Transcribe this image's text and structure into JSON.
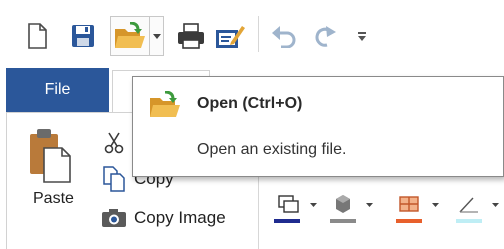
{
  "colors": {
    "file_tab_bg": "#2b579a",
    "icon_blue": "#2b579a",
    "folder_orange": "#e3a537",
    "arrow_green": "#3d9a3d",
    "disabled_gray": "#9fb4cc"
  },
  "quick_access_toolbar": {
    "buttons": [
      {
        "icon": "new-document-icon"
      },
      {
        "icon": "save-icon"
      },
      {
        "icon": "open-folder-icon",
        "has_dropdown": true
      },
      {
        "icon": "print-icon"
      },
      {
        "icon": "print-edit-icon"
      },
      {
        "icon": "undo-icon",
        "enabled": false
      },
      {
        "icon": "redo-icon",
        "enabled": false
      },
      {
        "icon": "customize-toolbar-icon"
      }
    ]
  },
  "ribbon": {
    "tabs": [
      {
        "label": "File",
        "active": false
      }
    ],
    "clipboard": {
      "paste_label": "Paste",
      "copy_label": "Copy",
      "copy_image_label": "Copy Image"
    }
  },
  "tooltip": {
    "title": "Open (Ctrl+O)",
    "description": "Open an existing file."
  }
}
